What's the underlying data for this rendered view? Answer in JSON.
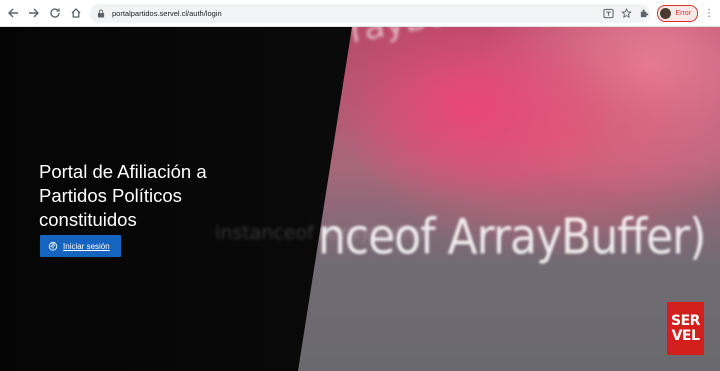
{
  "browser": {
    "url": "portalpartidos.servel.cl/auth/login",
    "profile_label": "Error"
  },
  "hero": {
    "title_lines": [
      "Portal de Afiliación a",
      "Partidos Políticos",
      "constituidos"
    ],
    "login_button": "Iniciar sesión"
  },
  "background": {
    "text_main": "nceof ArrayBuffer)",
    "text_top": "al ArrayBuffer",
    "text_mid": "instanceof ArrayBuffer"
  },
  "logo": {
    "line1": "SER",
    "line2": "VEL"
  },
  "colors": {
    "button": "#1565c0",
    "logo": "#d21f1b",
    "profile_error": "#d93025"
  },
  "icons": [
    "back-arrow-icon",
    "forward-arrow-icon",
    "reload-icon",
    "home-icon",
    "lock-icon",
    "translate-icon",
    "bookmark-star-icon",
    "extensions-icon",
    "fingerprint-icon",
    "menu-dots-icon"
  ]
}
